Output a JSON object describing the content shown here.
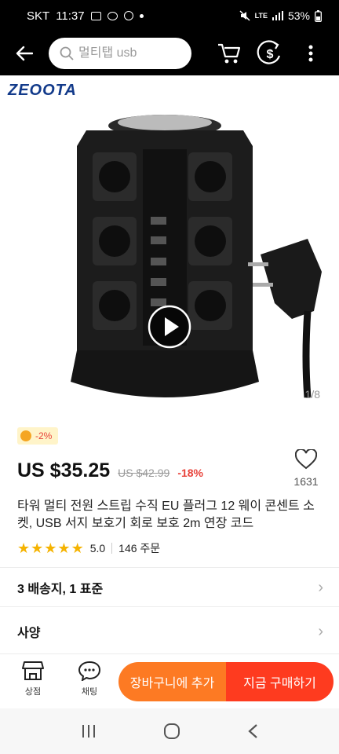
{
  "status": {
    "carrier": "SKT",
    "time": "11:37",
    "network": "LTE",
    "battery": "53%"
  },
  "search": {
    "placeholder": "멀티탭 usb"
  },
  "gallery": {
    "brand": "ZEOOTA",
    "page_indicator": "1/8"
  },
  "product": {
    "coupon": "-2%",
    "price": "US $35.25",
    "old_price": "US $42.99",
    "discount": "-18%",
    "wishlist_count": "1631",
    "title": "타워 멀티 전원 스트립 수직 EU 플러그 12 웨이 콘센트 소켓, USB 서지 보호기 회로 보호 2m 연장 코드",
    "rating": "5.0",
    "rating_stars": 5,
    "orders": "146 주문"
  },
  "rows": {
    "shipping": "3 배송지, 1 표준",
    "specs": "사양"
  },
  "bottom": {
    "store_label": "상점",
    "chat_label": "채팅",
    "cart_label": "장바구니에 추가",
    "buy_label": "지금 구매하기"
  },
  "colors": {
    "cart": "#fd7a23",
    "buy": "#fe3b1f",
    "star": "#f5b301",
    "discount": "#e8423a"
  }
}
